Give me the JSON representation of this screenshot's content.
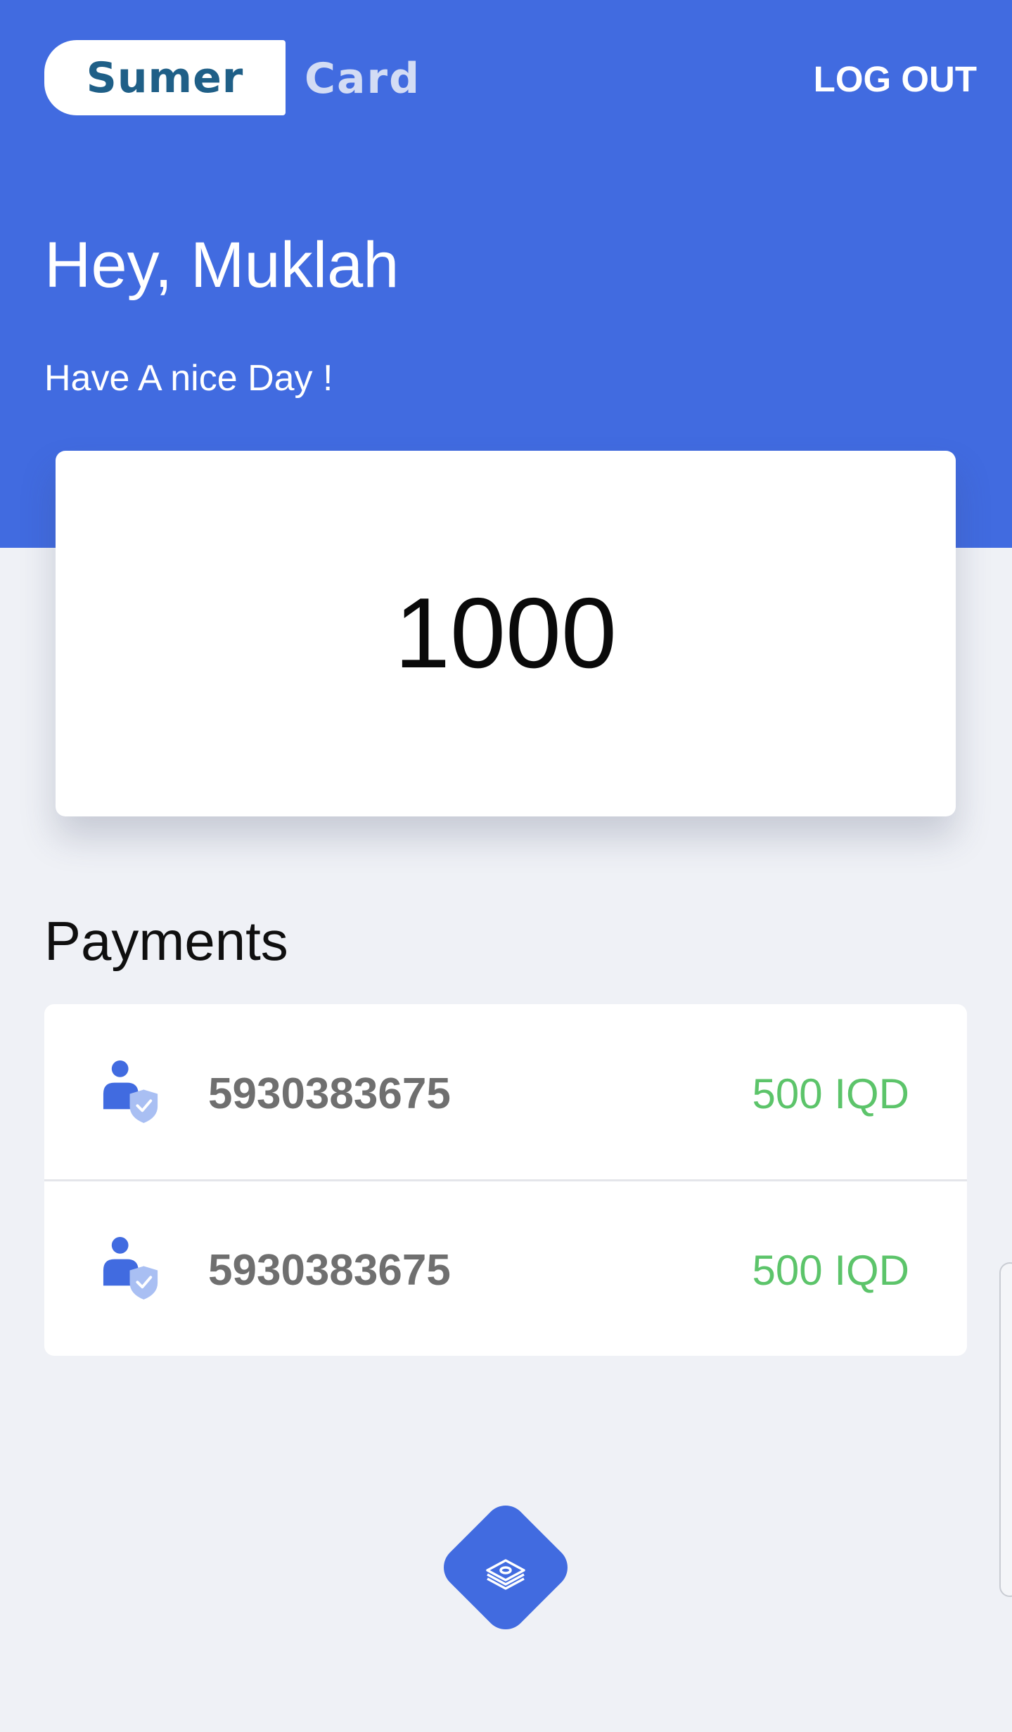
{
  "header": {
    "logo_primary": "Sumer",
    "logo_secondary": "Card",
    "logout_label": "LOG OUT"
  },
  "greeting": {
    "title": "Hey, Muklah",
    "subtitle": "Have A nice Day !"
  },
  "balance": {
    "value": "1000"
  },
  "payments": {
    "title": "Payments",
    "items": [
      {
        "number": "5930383675",
        "amount": "500 IQD",
        "icon": "verified-user-icon"
      },
      {
        "number": "5930383675",
        "amount": "500 IQD",
        "icon": "verified-user-icon"
      }
    ]
  },
  "fab": {
    "icon": "money-stack-icon"
  },
  "colors": {
    "primary": "#416be0",
    "background": "#eff1f6",
    "amount_green": "#5cc46a",
    "number_gray": "#6f6f6f",
    "logo_blue": "#1f5f87"
  }
}
